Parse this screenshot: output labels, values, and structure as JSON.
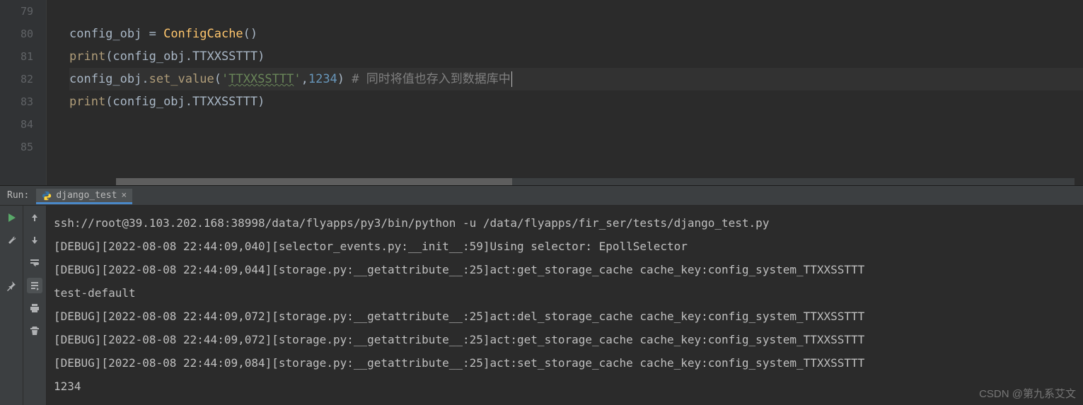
{
  "editor": {
    "lines": [
      {
        "num": "79",
        "tokens": []
      },
      {
        "num": "80",
        "tokens": [
          {
            "t": "config_obj ",
            "c": "tok-id"
          },
          {
            "t": "= ",
            "c": "tok-punc"
          },
          {
            "t": "ConfigCache",
            "c": "tok-fn"
          },
          {
            "t": "()",
            "c": "tok-punc"
          }
        ]
      },
      {
        "num": "81",
        "tokens": [
          {
            "t": "print",
            "c": "tok-call"
          },
          {
            "t": "(config_obj.TTXXSSTTT)",
            "c": "tok-punc"
          }
        ]
      },
      {
        "num": "82",
        "active": true,
        "tokens": [
          {
            "t": "config_obj.",
            "c": "tok-id"
          },
          {
            "t": "set_value",
            "c": "tok-call"
          },
          {
            "t": "(",
            "c": "tok-punc"
          },
          {
            "t": "'",
            "c": "tok-str"
          },
          {
            "t": "TTXXSSTTT",
            "c": "tok-str typo"
          },
          {
            "t": "'",
            "c": "tok-str"
          },
          {
            "t": ",",
            "c": "tok-punc"
          },
          {
            "t": "1234",
            "c": "tok-num"
          },
          {
            "t": ") ",
            "c": "tok-punc"
          },
          {
            "t": "# 同时将值也存入到数据库中",
            "c": "tok-cmt"
          }
        ],
        "cursor": true
      },
      {
        "num": "83",
        "tokens": [
          {
            "t": "print",
            "c": "tok-call"
          },
          {
            "t": "(config_obj.TTXXSSTTT)",
            "c": "tok-punc"
          }
        ]
      },
      {
        "num": "84",
        "tokens": []
      },
      {
        "num": "85",
        "tokens": []
      }
    ]
  },
  "run": {
    "label": "Run:",
    "tab_name": "django_test",
    "output": [
      "ssh://root@39.103.202.168:38998/data/flyapps/py3/bin/python -u /data/flyapps/fir_ser/tests/django_test.py",
      "[DEBUG][2022-08-08 22:44:09,040][selector_events.py:__init__:59]Using selector: EpollSelector",
      "[DEBUG][2022-08-08 22:44:09,044][storage.py:__getattribute__:25]act:get_storage_cache cache_key:config_system_TTXXSSTTT",
      "test-default",
      "[DEBUG][2022-08-08 22:44:09,072][storage.py:__getattribute__:25]act:del_storage_cache cache_key:config_system_TTXXSSTTT",
      "[DEBUG][2022-08-08 22:44:09,072][storage.py:__getattribute__:25]act:get_storage_cache cache_key:config_system_TTXXSSTTT",
      "[DEBUG][2022-08-08 22:44:09,084][storage.py:__getattribute__:25]act:set_storage_cache cache_key:config_system_TTXXSSTTT",
      "1234"
    ]
  },
  "watermark": "CSDN @第九系艾文"
}
